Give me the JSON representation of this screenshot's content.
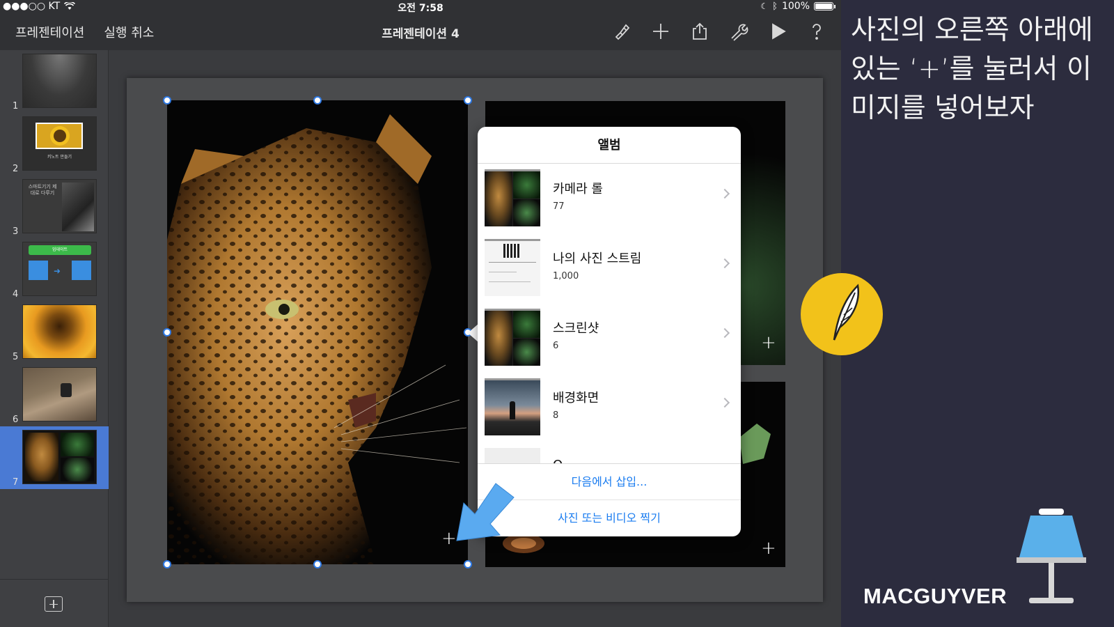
{
  "status": {
    "carrier": "●●●○○ KT",
    "time": "오전 7:58",
    "battery": "100%"
  },
  "toolbar": {
    "presentations_label": "프레젠테이션",
    "undo_label": "실행 취소",
    "title": "프레젠테이션 4"
  },
  "navigator": {
    "slides": [
      {
        "number": "1",
        "caption": ""
      },
      {
        "number": "2",
        "caption": "키노트 만들기"
      },
      {
        "number": "3",
        "caption": "스마트기기 제대로 다루기"
      },
      {
        "number": "4",
        "caption": "업데이트"
      },
      {
        "number": "5",
        "caption": ""
      },
      {
        "number": "6",
        "caption": ""
      },
      {
        "number": "7",
        "caption": ""
      }
    ],
    "selected": "7"
  },
  "popover": {
    "title": "앨범",
    "albums": [
      {
        "name": "카메라 롤",
        "count": "77"
      },
      {
        "name": "나의 사진 스트림",
        "count": "1,000"
      },
      {
        "name": "스크린샷",
        "count": "6"
      },
      {
        "name": "배경화면",
        "count": "8"
      },
      {
        "name": "Q...",
        "count": ""
      }
    ],
    "insert_from": "다음에서 삽입...",
    "take_photo": "사진 또는 비디오 찍기"
  },
  "panel": {
    "caption": "사진의 오른쪽 아래에 있는 ‘+’를 눌러서 이미지를 넣어보자",
    "brand": "MACGUYVER"
  },
  "colors": {
    "selection": "#4a7ad4",
    "handle": "#2f7ae5",
    "link": "#1a7cf0",
    "badge": "#f2c21a",
    "arrow": "#5aaaf0"
  }
}
